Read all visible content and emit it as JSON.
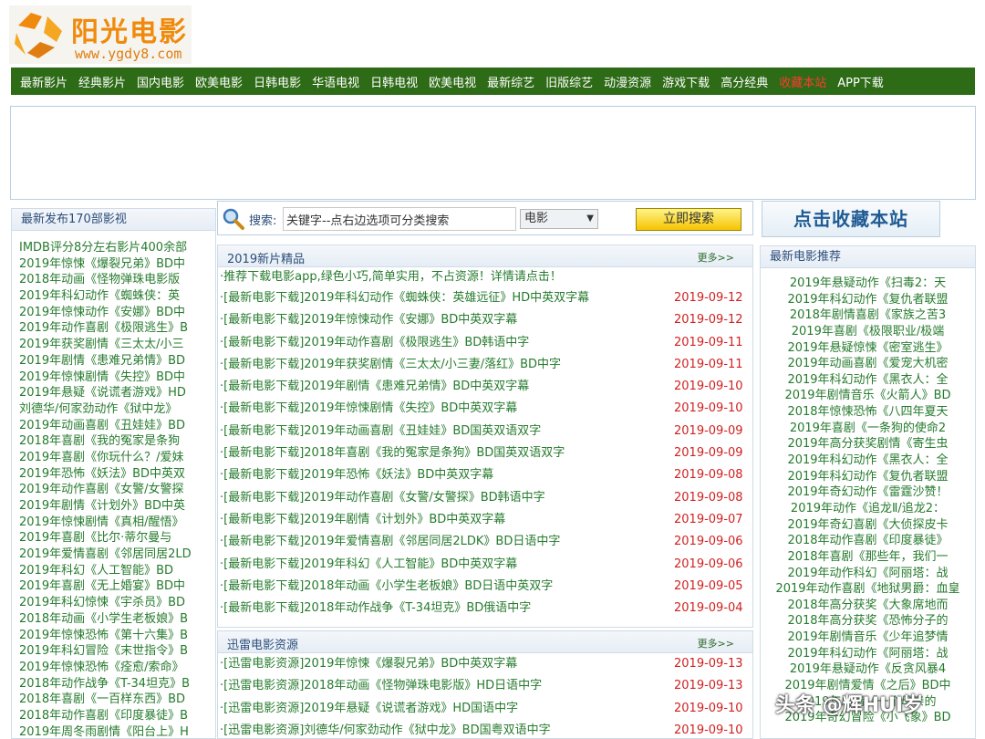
{
  "logo": {
    "title": "阳光电影",
    "url": "www.ygdy8.com"
  },
  "nav": [
    {
      "label": "最新影片"
    },
    {
      "label": "经典影片"
    },
    {
      "label": "国内电影"
    },
    {
      "label": "欧美电影"
    },
    {
      "label": "日韩电影"
    },
    {
      "label": "华语电视"
    },
    {
      "label": "日韩电视"
    },
    {
      "label": "欧美电视"
    },
    {
      "label": "最新综艺"
    },
    {
      "label": "旧版综艺"
    },
    {
      "label": "动漫资源"
    },
    {
      "label": "游戏下载"
    },
    {
      "label": "高分经典"
    },
    {
      "label": "收藏本站"
    },
    {
      "label": "APP下载"
    }
  ],
  "colors": {
    "nav_bg": "#2e6b17",
    "link": "#267b2d",
    "date": "#d22020",
    "hot": "#ff3b30",
    "head": "#2b4d7a"
  },
  "left": {
    "title": "最新发布170部影视",
    "items": [
      "IMDB评分8分左右影片400余部",
      "2019年惊悚《爆裂兄弟》BD中",
      "2018年动画《怪物弹珠电影版",
      "2019年科幻动作《蜘蛛侠：英",
      "2019年惊悚动作《安娜》BD中",
      "2019年动作喜剧《极限逃生》B",
      "2019年获奖剧情《三太太/小三",
      "2019年剧情《患难兄弟情》BD",
      "2019年惊悚剧情《失控》BD中",
      "2019年悬疑《说谎者游戏》HD",
      "刘德华/何家劲动作《狱中龙》",
      "2019年动画喜剧《丑娃娃》BD",
      "2018年喜剧《我的冤家是条狗",
      "2019年喜剧《你玩什么？/爱妹",
      "2019年恐怖《妖法》BD中英双",
      "2019年动作喜剧《女警/女警探",
      "2019年剧情《计划外》BD中英",
      "2019年惊悚剧情《真相/醒悟》",
      "2019年喜剧《比尔·蒂尔曼与",
      "2019年爱情喜剧《邻居同居2LD",
      "2019年科幻《人工智能》BD",
      "2019年喜剧《无上婚宴》BD中",
      "2019年科幻惊悚《宇杀员》BD",
      "2018年动画《小学生老板娘》B",
      "2019年惊悚恐怖《第十六集》B",
      "2019年科幻冒险《末世指令》B",
      "2019年惊悚恐怖《痊愈/索命》",
      "2018年动作战争《T-34坦克》B",
      "2018年喜剧《一百样东西》BD",
      "2018年动作喜剧《印度暴徒》B",
      "2019年周冬雨剧情《阳台上》H"
    ]
  },
  "search": {
    "label": "搜索:",
    "placeholder": "关键字--点右边选项可分类搜索",
    "select_value": "电影",
    "button": "立即搜索"
  },
  "favorite": {
    "label": "点击收藏本站"
  },
  "new_panel": {
    "title": "2019新片精品",
    "more": "更多>>",
    "notice": "·推荐下载电影app,绿色小巧,简单实用，不占资源！详情请点击！",
    "rows": [
      {
        "title": "·[最新电影下载]2019年科幻动作《蜘蛛侠：英雄远征》HD中英双字幕",
        "date": "2019-09-12"
      },
      {
        "title": "·[最新电影下载]2019年惊悚动作《安娜》BD中英双字幕",
        "date": "2019-09-12"
      },
      {
        "title": "·[最新电影下载]2019年动作喜剧《极限逃生》BD韩语中字",
        "date": "2019-09-11"
      },
      {
        "title": "·[最新电影下载]2019年获奖剧情《三太太/小三妻/落红》BD中字",
        "date": "2019-09-11"
      },
      {
        "title": "·[最新电影下载]2019年剧情《患难兄弟情》BD中英双字幕",
        "date": "2019-09-10"
      },
      {
        "title": "·[最新电影下载]2019年惊悚剧情《失控》BD中英双字幕",
        "date": "2019-09-10"
      },
      {
        "title": "·[最新电影下载]2019年动画喜剧《丑娃娃》BD国英双语双字",
        "date": "2019-09-09"
      },
      {
        "title": "·[最新电影下载]2018年喜剧《我的冤家是条狗》BD国英双语双字",
        "date": "2019-09-09"
      },
      {
        "title": "·[最新电影下载]2019年恐怖《妖法》BD中英双字幕",
        "date": "2019-09-08"
      },
      {
        "title": "·[最新电影下载]2019年动作喜剧《女警/女警探》BD韩语中字",
        "date": "2019-09-08"
      },
      {
        "title": "·[最新电影下载]2019年剧情《计划外》BD中英双字幕",
        "date": "2019-09-07"
      },
      {
        "title": "·[最新电影下载]2019年爱情喜剧《邻居同居2LDK》BD日语中字",
        "date": "2019-09-06"
      },
      {
        "title": "·[最新电影下载]2019年科幻《人工智能》BD中英双字幕",
        "date": "2019-09-06"
      },
      {
        "title": "·[最新电影下载]2018年动画《小学生老板娘》BD日语中英双字",
        "date": "2019-09-05"
      },
      {
        "title": "·[最新电影下载]2018年动作战争《T-34坦克》BD俄语中字",
        "date": "2019-09-04"
      }
    ]
  },
  "thunder_panel": {
    "title": "迅雷电影资源",
    "more": "更多>>",
    "rows": [
      {
        "title": "·[迅雷电影资源]2019年惊悚《爆裂兄弟》BD中英双字幕",
        "date": "2019-09-13"
      },
      {
        "title": "·[迅雷电影资源]2018年动画《怪物弹珠电影版》HD日语中字",
        "date": "2019-09-13"
      },
      {
        "title": "·[迅雷电影资源]2019年悬疑《说谎者游戏》HD国语中字",
        "date": "2019-09-10"
      },
      {
        "title": "·[迅雷电影资源]刘德华/何家劲动作《狱中龙》BD国粤双语中字",
        "date": "2019-09-10"
      }
    ]
  },
  "right": {
    "title": "最新电影推荐",
    "items": [
      "2019年悬疑动作《扫毒2：天",
      "2019年科幻动作《复仇者联盟",
      "2018年剧情喜剧《家族之苦3",
      "2019年喜剧《极限职业/极端",
      "2019年悬疑惊悚《密室逃生》",
      "2019年动画喜剧《爱宠大机密",
      "2019年科幻动作《黑衣人：全",
      "2019年剧情音乐《火箭人》BD",
      "2018年惊悚恐怖《八四年夏天",
      "2019年喜剧《一条狗的使命2",
      "2019年高分获奖剧情《寄生虫",
      "2019年科幻动作《黑衣人：全",
      "2019年科幻动作《复仇者联盟",
      "2019年奇幻动作《雷霆沙赞！",
      "2019年动作《追龙Ⅱ/追龙2：",
      "2019年奇幻喜剧《大侦探皮卡",
      "2018年动作喜剧《印度暴徒》",
      "2018年喜剧《那些年，我们一",
      "2019年动作科幻《阿丽塔：战",
      "2019年动作喜剧《地狱男爵：血皇",
      "2018年高分获奖《大象席地而",
      "2018年高分获奖《恐怖分子的",
      "2019年剧情音乐《少年追梦情",
      "2019年科幻动作《阿丽塔：战",
      "2019年悬疑动作《反贪风暴4",
      "2019年剧情爱情《之后》BD中",
      "2019年剧情《一个母亲的",
      "2019年奇幻冒险《小飞象》BD"
    ]
  },
  "watermark": "头条 @辉HUI岁"
}
